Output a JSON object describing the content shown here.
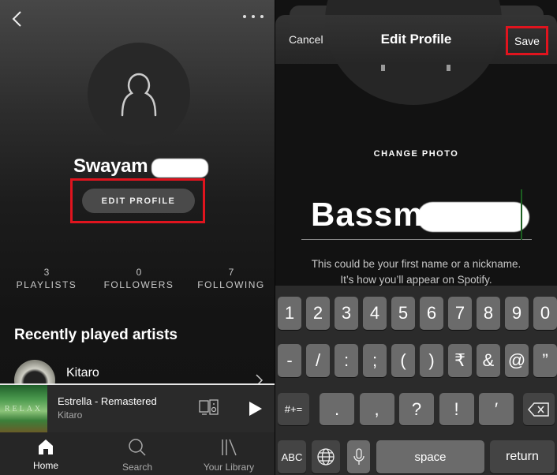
{
  "left": {
    "header": {
      "back_icon": "chevron-left-icon",
      "more_icon": "more-dots-icon"
    },
    "profile": {
      "name_visible": "Swayam",
      "edit_button": "EDIT PROFILE"
    },
    "stats": [
      {
        "value": "3",
        "label": "PLAYLISTS"
      },
      {
        "value": "0",
        "label": "FOLLOWERS"
      },
      {
        "value": "7",
        "label": "FOLLOWING"
      }
    ],
    "recently_played": {
      "heading": "Recently played artists",
      "artists": [
        {
          "name": "Kitaro"
        }
      ]
    },
    "now_playing": {
      "title": "Estrella - Remastered",
      "artist": "Kitaro",
      "art_text": "RELAX"
    },
    "tabs": [
      {
        "label": "Home",
        "icon": "home-icon",
        "active": true
      },
      {
        "label": "Search",
        "icon": "search-icon",
        "active": false
      },
      {
        "label": "Your Library",
        "icon": "library-icon",
        "active": false
      }
    ]
  },
  "right": {
    "navbar": {
      "cancel": "Cancel",
      "title": "Edit Profile",
      "save": "Save"
    },
    "change_photo": "CHANGE PHOTO",
    "name_input": {
      "value_visible": "Bassm"
    },
    "hint_line1": "This could be your first name or a nickname.",
    "hint_line2": "It’s how you’ll appear on Spotify.",
    "keyboard": {
      "row1": [
        "1",
        "2",
        "3",
        "4",
        "5",
        "6",
        "7",
        "8",
        "9",
        "0"
      ],
      "row2": [
        "-",
        "/",
        ":",
        ";",
        "(",
        ")",
        "₹",
        "&",
        "@",
        "”"
      ],
      "row3": {
        "mode": "#+=",
        "keys": [
          ".",
          ",",
          "?",
          "!",
          "′"
        ],
        "delete_icon": "backspace-icon"
      },
      "row4": {
        "abc": "ABC",
        "globe_icon": "globe-icon",
        "mic_icon": "microphone-icon",
        "space": "space",
        "return": "return"
      }
    }
  },
  "colors": {
    "highlight": "#e0141e",
    "background": "#121212"
  }
}
